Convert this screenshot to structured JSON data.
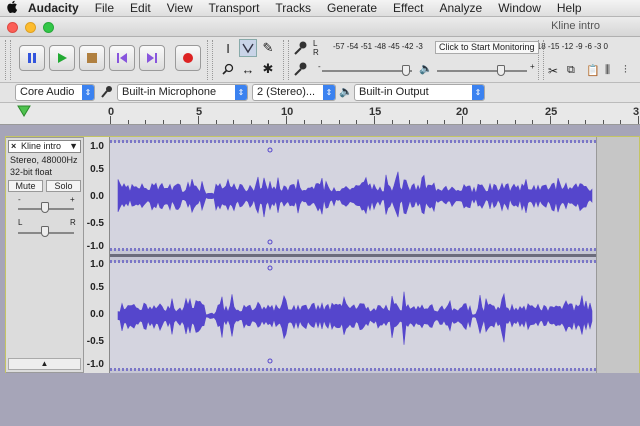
{
  "menubar": {
    "apple_icon": "apple-logo-icon",
    "items": [
      "Audacity",
      "File",
      "Edit",
      "View",
      "Transport",
      "Tracks",
      "Generate",
      "Effect",
      "Analyze",
      "Window",
      "Help"
    ]
  },
  "window": {
    "title": "Kline intro",
    "traffic_light_colors": [
      "#fc5f57",
      "#fdbc2e",
      "#33c748"
    ]
  },
  "transport": {
    "buttons": [
      {
        "name": "pause",
        "icon": "pause-icon",
        "color": "#3355dd"
      },
      {
        "name": "play",
        "icon": "play-icon",
        "color": "#22aa33"
      },
      {
        "name": "stop",
        "icon": "stop-icon",
        "color": "#b08040"
      },
      {
        "name": "skip-start",
        "icon": "skip-start-icon",
        "color": "#8855dd"
      },
      {
        "name": "skip-end",
        "icon": "skip-end-icon",
        "color": "#8855dd"
      },
      {
        "name": "record",
        "icon": "record-icon",
        "color": "#dd2222"
      }
    ]
  },
  "tools": {
    "items": [
      {
        "name": "selection-tool",
        "glyph": "I"
      },
      {
        "name": "envelope-tool",
        "glyph": "⋎"
      },
      {
        "name": "draw-tool",
        "glyph": "✎"
      },
      {
        "name": "zoom-tool",
        "glyph": "⚲"
      },
      {
        "name": "timeshift-tool",
        "glyph": "↔"
      },
      {
        "name": "multi-tool",
        "glyph": "✱"
      }
    ]
  },
  "meter": {
    "record_label_l": "L",
    "record_label_r": "R",
    "scale": "-57 -54 -51 -48 -45 -42 -3",
    "scale_tail": "21 -18 -15 -12  -9  -6  -3  0",
    "monitor_tip": "Click to Start Monitoring"
  },
  "devices": {
    "host": "Core Audio",
    "input": "Built-in Microphone",
    "channels": "2 (Stereo)...",
    "output": "Built-in Output"
  },
  "ruler": {
    "labels": [
      "0",
      "5",
      "10",
      "15",
      "20",
      "25",
      "3"
    ]
  },
  "track": {
    "name": "Kline intro",
    "format": "Stereo, 48000Hz",
    "bits": "32-bit float",
    "mute_label": "Mute",
    "solo_label": "Solo",
    "gain_minus": "-",
    "gain_plus": "+",
    "pan_left": "L",
    "pan_right": "R",
    "wave_color": "#5546cc",
    "scale_top": [
      "1.0",
      "0.5",
      "0.0",
      "-0.5",
      "-1.0"
    ],
    "scale_bottom": [
      "1.0",
      "0.5",
      "0.0",
      "-0.5",
      "-1.0"
    ]
  }
}
